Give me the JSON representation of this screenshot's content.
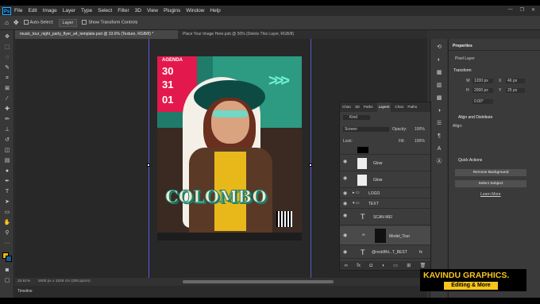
{
  "menu": {
    "app": "Ps",
    "items": [
      "File",
      "Edit",
      "Image",
      "Layer",
      "Type",
      "Select",
      "Filter",
      "3D",
      "View",
      "Plugins",
      "Window",
      "Help"
    ]
  },
  "options": {
    "auto_select": "Auto-Select:",
    "layer_select": "Layer",
    "show_transform": "Show Transform Controls"
  },
  "tabs": [
    "music_tour_night_party_flyer_a4_template.psd @ 33.6% (Texture, RGB/8) *",
    "Place Your Image Here.psb @ 50% (Delete This Layer, RGB/8)"
  ],
  "status": {
    "zoom": "33.61%",
    "doc": "1600 px x 1528 cm (200 ppcm)",
    "timeline": "Timeline"
  },
  "flyer": {
    "agenda": "AGENDA",
    "day1": "30",
    "day2": "31",
    "day3": "01",
    "title": "COLOMBO",
    "colors": {
      "accent": "#e3194d",
      "teal": "#1f7c6a",
      "title_fill": "#f1ead2",
      "title_stroke": "#1c7f6c"
    }
  },
  "props": {
    "tab": "Properties",
    "pixel_layer": "Pixel Layer",
    "transform": "Transform",
    "w_label": "W",
    "w_value": "1200 px",
    "h_label": "H",
    "h_value": "2000 px",
    "x_label": "X",
    "x_value": "46 px",
    "y_label": "Y",
    "y_value": "25 px",
    "angle": "0.00°",
    "align": "Align and Distribute",
    "align_sub": "Align:",
    "quick": "Quick Actions",
    "remove_bg": "Remove Background",
    "select_subject": "Select Subject",
    "learn_more": "Learn More"
  },
  "layers": {
    "tabs": [
      "Chan",
      "3D",
      "Paths",
      "Layers",
      "Chan",
      "Paths"
    ],
    "kind": "Kind",
    "blend": "Screen",
    "opacity_label": "Opacity:",
    "opacity": "100%",
    "lock_label": "Lock:",
    "fill_label": "Fill:",
    "fill": "100%",
    "rows": [
      {
        "name": ""
      },
      {
        "name": "Glow"
      },
      {
        "name": "Glow"
      },
      {
        "name": "LOGO"
      },
      {
        "name": "TEXT"
      },
      {
        "name": "SCAN ME!"
      },
      {
        "name": "Model_Tour"
      },
      {
        "name": "@rockBhl...T_BEST"
      }
    ]
  },
  "brand": {
    "name": "KAVINDU GRAPHICS.",
    "tagline": "Editing & More"
  }
}
